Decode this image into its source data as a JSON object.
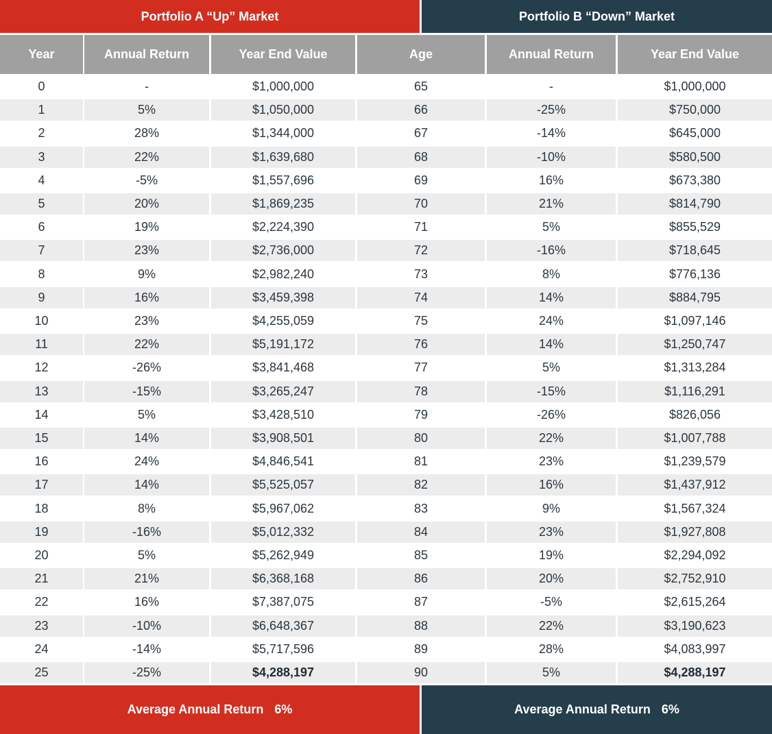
{
  "portfolio_a": {
    "title": "Portfolio A “Up” Market",
    "columns": [
      "Year",
      "Annual Return",
      "Year End Value"
    ],
    "footer_label": "Average Annual Return",
    "footer_value": "6%",
    "color": "#d22e1f",
    "rows": [
      {
        "key": "0",
        "ret": "-",
        "value": "$1,000,000"
      },
      {
        "key": "1",
        "ret": "5%",
        "value": "$1,050,000"
      },
      {
        "key": "2",
        "ret": "28%",
        "value": "$1,344,000"
      },
      {
        "key": "3",
        "ret": "22%",
        "value": "$1,639,680"
      },
      {
        "key": "4",
        "ret": "-5%",
        "value": "$1,557,696"
      },
      {
        "key": "5",
        "ret": "20%",
        "value": "$1,869,235"
      },
      {
        "key": "6",
        "ret": "19%",
        "value": "$2,224,390"
      },
      {
        "key": "7",
        "ret": "23%",
        "value": "$2,736,000"
      },
      {
        "key": "8",
        "ret": "9%",
        "value": "$2,982,240"
      },
      {
        "key": "9",
        "ret": "16%",
        "value": "$3,459,398"
      },
      {
        "key": "10",
        "ret": "23%",
        "value": "$4,255,059"
      },
      {
        "key": "11",
        "ret": "22%",
        "value": "$5,191,172"
      },
      {
        "key": "12",
        "ret": "-26%",
        "value": "$3,841,468"
      },
      {
        "key": "13",
        "ret": "-15%",
        "value": "$3,265,247"
      },
      {
        "key": "14",
        "ret": "5%",
        "value": "$3,428,510"
      },
      {
        "key": "15",
        "ret": "14%",
        "value": "$3,908,501"
      },
      {
        "key": "16",
        "ret": "24%",
        "value": "$4,846,541"
      },
      {
        "key": "17",
        "ret": "14%",
        "value": "$5,525,057"
      },
      {
        "key": "18",
        "ret": "8%",
        "value": "$5,967,062"
      },
      {
        "key": "19",
        "ret": "-16%",
        "value": "$5,012,332"
      },
      {
        "key": "20",
        "ret": "5%",
        "value": "$5,262,949"
      },
      {
        "key": "21",
        "ret": "21%",
        "value": "$6,368,168"
      },
      {
        "key": "22",
        "ret": "16%",
        "value": "$7,387,075"
      },
      {
        "key": "23",
        "ret": "-10%",
        "value": "$6,648,367"
      },
      {
        "key": "24",
        "ret": "-14%",
        "value": "$5,717,596"
      },
      {
        "key": "25",
        "ret": "-25%",
        "value": "$4,288,197",
        "bold": true
      }
    ]
  },
  "portfolio_b": {
    "title": "Portfolio B “Down” Market",
    "columns": [
      "Age",
      "Annual Return",
      "Year End Value"
    ],
    "footer_label": "Average Annual Return",
    "footer_value": "6%",
    "color": "#253e4c",
    "rows": [
      {
        "key": "65",
        "ret": "-",
        "value": "$1,000,000"
      },
      {
        "key": "66",
        "ret": "-25%",
        "value": "$750,000"
      },
      {
        "key": "67",
        "ret": "-14%",
        "value": "$645,000"
      },
      {
        "key": "68",
        "ret": "-10%",
        "value": "$580,500"
      },
      {
        "key": "69",
        "ret": "16%",
        "value": "$673,380"
      },
      {
        "key": "70",
        "ret": "21%",
        "value": "$814,790"
      },
      {
        "key": "71",
        "ret": "5%",
        "value": "$855,529"
      },
      {
        "key": "72",
        "ret": "-16%",
        "value": "$718,645"
      },
      {
        "key": "73",
        "ret": "8%",
        "value": "$776,136"
      },
      {
        "key": "74",
        "ret": "14%",
        "value": "$884,795"
      },
      {
        "key": "75",
        "ret": "24%",
        "value": "$1,097,146"
      },
      {
        "key": "76",
        "ret": "14%",
        "value": "$1,250,747"
      },
      {
        "key": "77",
        "ret": "5%",
        "value": "$1,313,284"
      },
      {
        "key": "78",
        "ret": "-15%",
        "value": "$1,116,291"
      },
      {
        "key": "79",
        "ret": "-26%",
        "value": "$826,056"
      },
      {
        "key": "80",
        "ret": "22%",
        "value": "$1,007,788"
      },
      {
        "key": "81",
        "ret": "23%",
        "value": "$1,239,579"
      },
      {
        "key": "82",
        "ret": "16%",
        "value": "$1,437,912"
      },
      {
        "key": "83",
        "ret": "9%",
        "value": "$1,567,324"
      },
      {
        "key": "84",
        "ret": "23%",
        "value": "$1,927,808"
      },
      {
        "key": "85",
        "ret": "19%",
        "value": "$2,294,092"
      },
      {
        "key": "86",
        "ret": "20%",
        "value": "$2,752,910"
      },
      {
        "key": "87",
        "ret": "-5%",
        "value": "$2,615,264"
      },
      {
        "key": "88",
        "ret": "22%",
        "value": "$3,190,623"
      },
      {
        "key": "89",
        "ret": "28%",
        "value": "$4,083,997"
      },
      {
        "key": "90",
        "ret": "5%",
        "value": "$4,288,197",
        "bold": true
      }
    ]
  }
}
